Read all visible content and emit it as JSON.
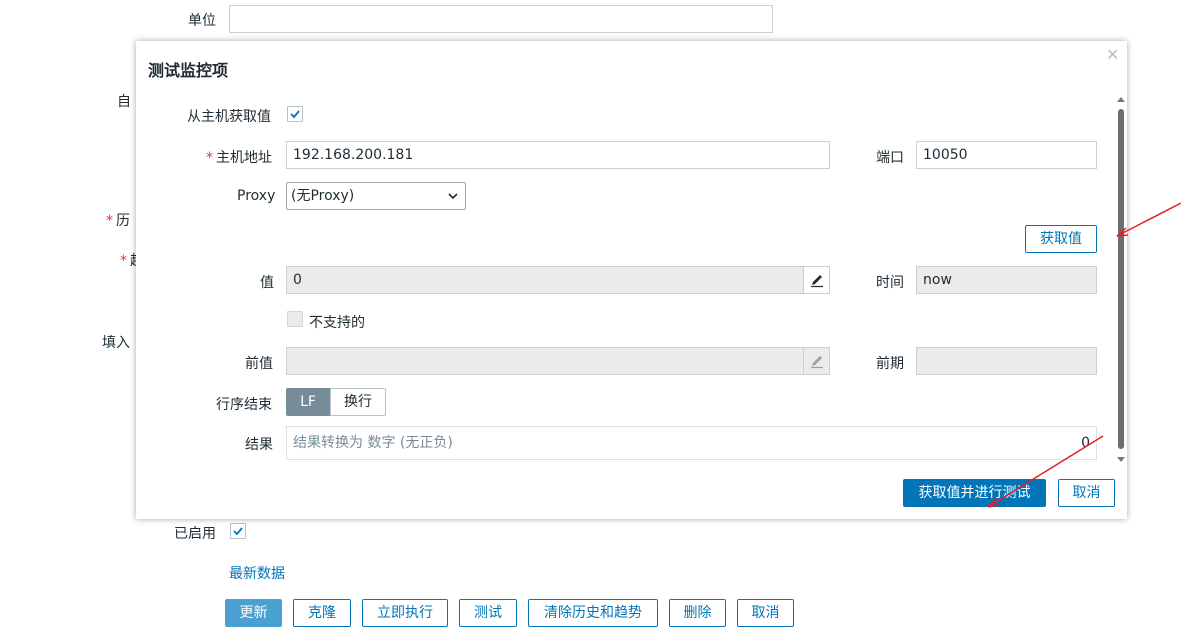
{
  "background_form": {
    "unit_label": "单位",
    "partial_labels": [
      "自",
      "历",
      "超",
      "填入"
    ],
    "enabled_label": "已启用",
    "enabled_checked": true,
    "latest_data_link": "最新数据",
    "buttons": {
      "update": "更新",
      "clone": "克隆",
      "execute_now": "立即执行",
      "test": "测试",
      "clear_history": "清除历史和趋势",
      "delete": "删除",
      "cancel": "取消"
    }
  },
  "modal": {
    "title": "测试监控项",
    "close_icon": "close-icon",
    "get_from_host_label": "从主机获取值",
    "get_from_host_checked": true,
    "host_address_label": "主机地址",
    "host_address_value": "192.168.200.181",
    "port_label": "端口",
    "port_value": "10050",
    "proxy_label": "Proxy",
    "proxy_value": "(无Proxy)",
    "get_value_button": "获取值",
    "value_label": "值",
    "value_value": "0",
    "time_label": "时间",
    "time_value": "now",
    "not_supported_label": "不支持的",
    "not_supported_checked": false,
    "prev_value_label": "前值",
    "prev_value_value": "",
    "prev_time_label": "前期",
    "prev_time_value": "",
    "eol_label": "行序结束",
    "eol_options": [
      "LF",
      "换行"
    ],
    "eol_selected": "LF",
    "result_label": "结果",
    "result_placeholder": "结果转换为 数字 (无正负)",
    "result_value": "0",
    "get_and_test_button": "获取值并进行测试",
    "cancel_button": "取消"
  },
  "colors": {
    "primary": "#0275b8",
    "required": "#e33734",
    "annotation": "#e32020"
  }
}
